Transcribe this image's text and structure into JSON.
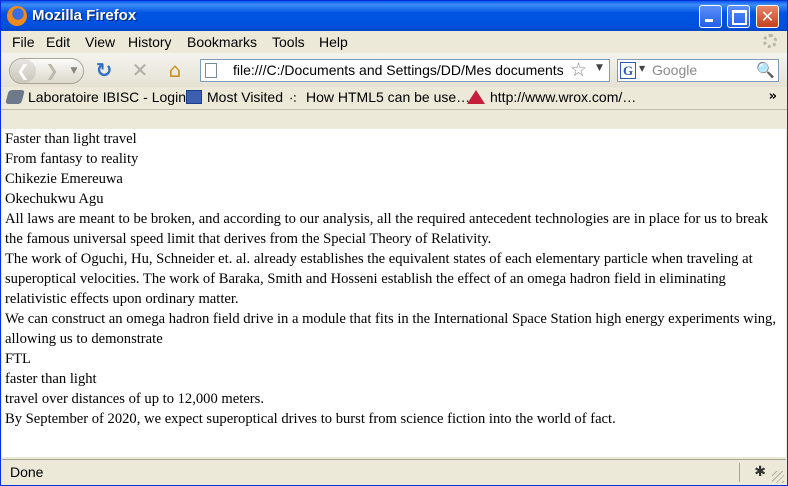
{
  "window": {
    "title": "Mozilla Firefox"
  },
  "menu": [
    "File",
    "Edit",
    "View",
    "History",
    "Bookmarks",
    "Tools",
    "Help"
  ],
  "navigation": {
    "url": "file:///C:/Documents and Settings/DD/Mes documents/",
    "search_placeholder": "Google"
  },
  "bookmarks": [
    {
      "label": "Laboratoire IBISC - Login",
      "icon": "ibisc-icon"
    },
    {
      "label": "Most Visited",
      "icon": "most-visited-icon"
    },
    {
      "label": "How HTML5 can be use…",
      "icon": "html5-icon"
    },
    {
      "label": "http://www.wrox.com/…",
      "icon": "wrox-icon"
    }
  ],
  "content": {
    "lines": [
      "Faster than light travel",
      "From fantasy to reality",
      "Chikezie Emereuwa",
      "Okechukwu Agu",
      "All laws are meant to be broken, and according to our analysis, all the required antecedent technologies are in place for us to break the famous universal speed limit that derives from the Special Theory of Relativity.",
      "The work of Oguchi, Hu, Schneider et. al. already establishes the equivalent states of each elementary particle when traveling at superoptical velocities. The work of Baraka, Smith and Hosseni establish the effect of an omega hadron field in eliminating relativistic effects upon ordinary matter.",
      "We can construct an omega hadron field drive in a module that fits in the International Space Station high energy experiments wing, allowing us to demonstrate",
      "FTL",
      "faster than light",
      "travel over distances of up to 12,000 meters.",
      "By September of 2020, we expect superoptical drives to burst from science fiction into the world of fact."
    ]
  },
  "status": {
    "text": "Done"
  },
  "colors": {
    "titlebar": "#0054e3",
    "chrome": "#ece9d8"
  }
}
